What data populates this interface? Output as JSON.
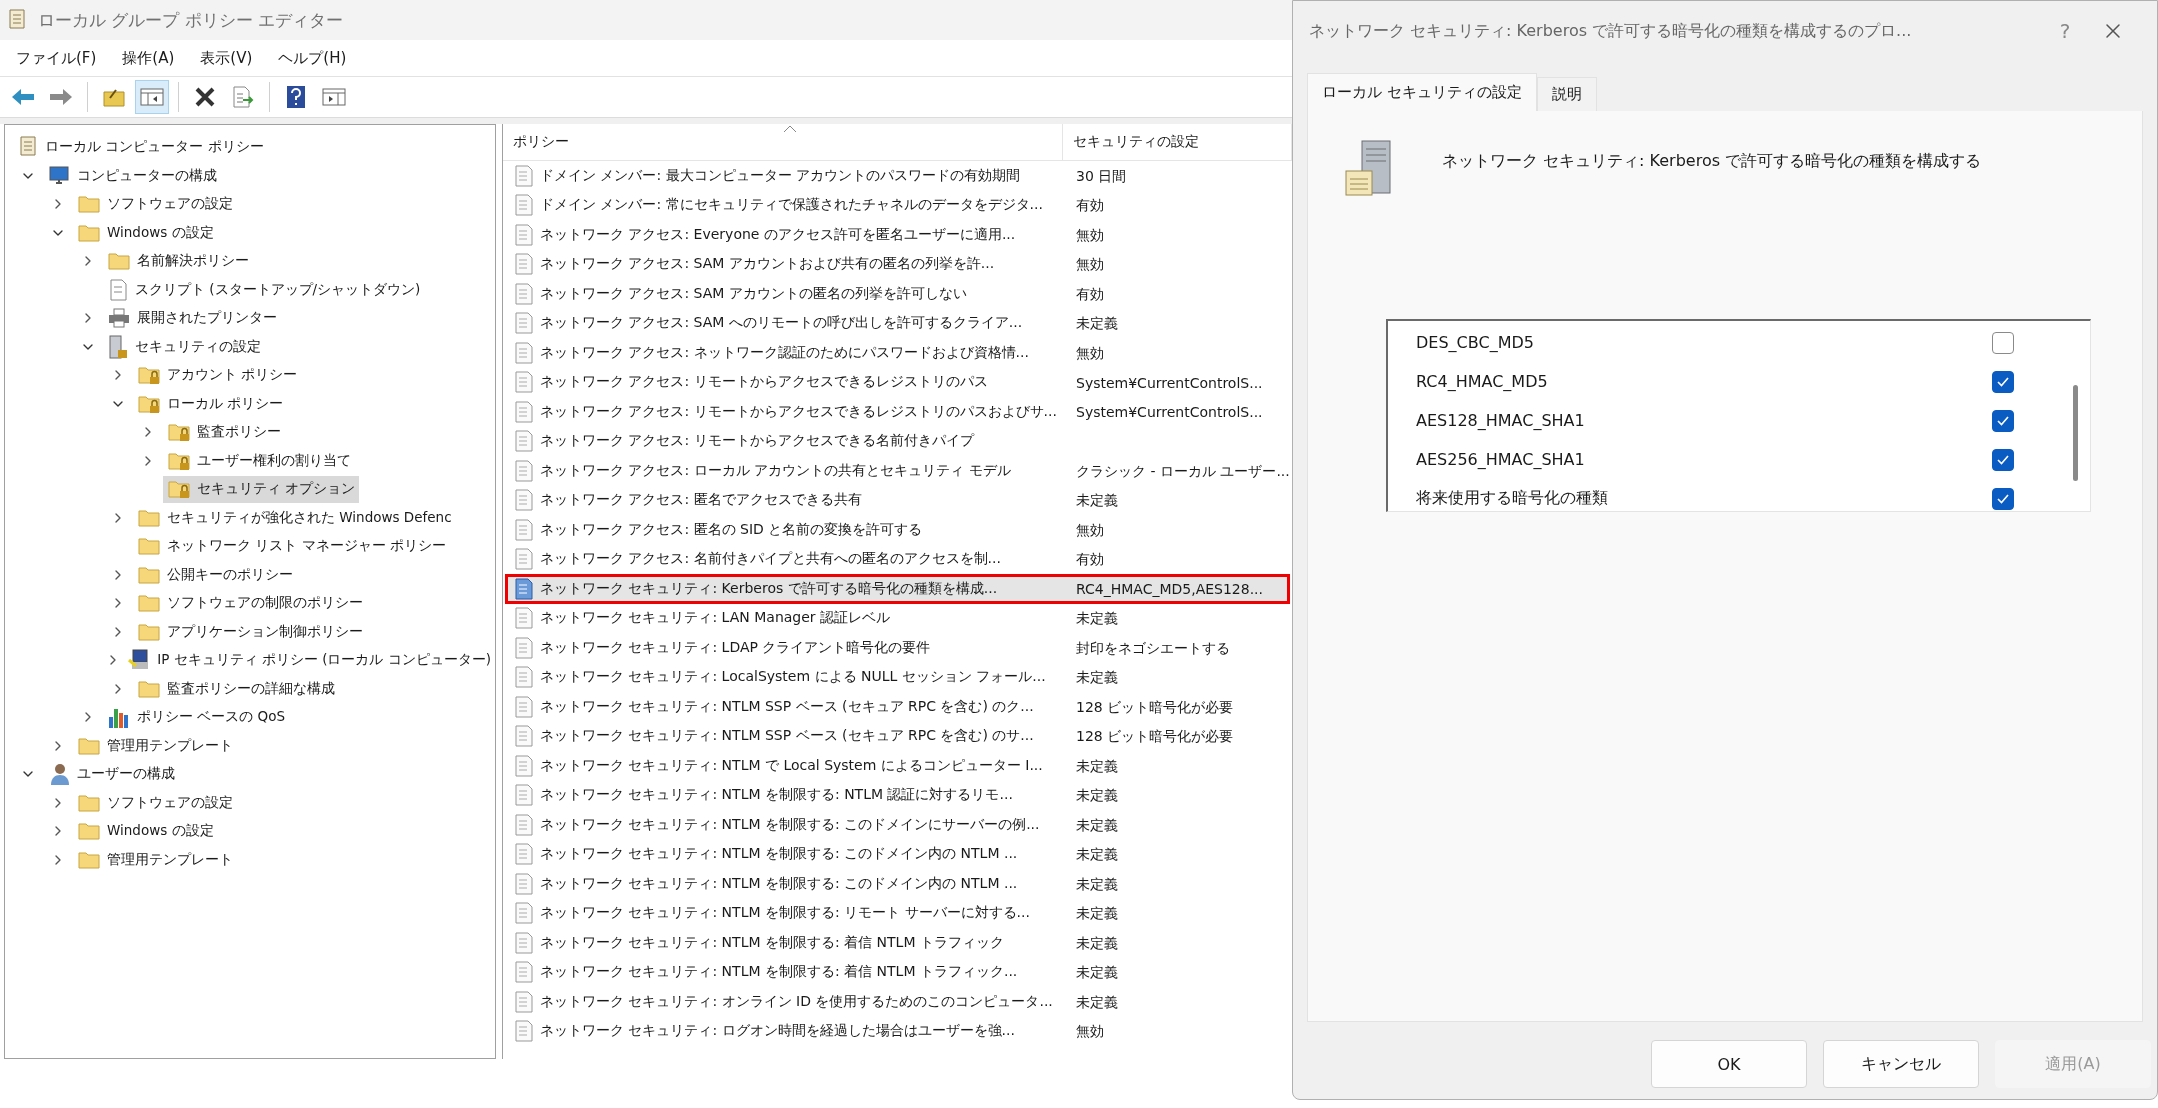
{
  "window": {
    "title": "ローカル グループ ポリシー エディター"
  },
  "menu": [
    "ファイル(F)",
    "操作(A)",
    "表示(V)",
    "ヘルプ(H)"
  ],
  "toolbar": [
    {
      "kind": "back",
      "pressed": false
    },
    {
      "kind": "forward",
      "pressed": false
    },
    {
      "kind": "separator"
    },
    {
      "kind": "up",
      "pressed": false
    },
    {
      "kind": "tree",
      "pressed": true
    },
    {
      "kind": "separator"
    },
    {
      "kind": "delete",
      "pressed": false
    },
    {
      "kind": "export",
      "pressed": false
    },
    {
      "kind": "separator"
    },
    {
      "kind": "help",
      "pressed": false
    },
    {
      "kind": "pane",
      "pressed": false
    }
  ],
  "tree": [
    {
      "label": "ローカル コンピューター ポリシー",
      "kind": "scroll",
      "selected": false,
      "children": [
        {
          "label": "コンピューターの構成",
          "kind": "computer",
          "expanded": true,
          "selected": false,
          "children": [
            {
              "label": "ソフトウェアの設定",
              "kind": "folder",
              "expanded": false,
              "selected": false
            },
            {
              "label": "Windows の設定",
              "kind": "folder",
              "expanded": true,
              "selected": false,
              "children": [
                {
                  "label": "名前解決ポリシー",
                  "kind": "folder",
                  "expanded": false,
                  "selected": false
                },
                {
                  "label": "スクリプト (スタートアップ/シャットダウン)",
                  "kind": "script",
                  "selected": false
                },
                {
                  "label": "展開されたプリンター",
                  "kind": "printer",
                  "expanded": false,
                  "selected": false
                },
                {
                  "label": "セキュリティの設定",
                  "kind": "server",
                  "expanded": true,
                  "selected": false,
                  "children": [
                    {
                      "label": "アカウント ポリシー",
                      "kind": "secure-folder",
                      "expanded": false,
                      "selected": false
                    },
                    {
                      "label": "ローカル ポリシー",
                      "kind": "secure-folder",
                      "expanded": true,
                      "selected": false,
                      "children": [
                        {
                          "label": "監査ポリシー",
                          "kind": "secure-folder",
                          "expanded": false,
                          "selected": false
                        },
                        {
                          "label": "ユーザー権利の割り当て",
                          "kind": "secure-folder",
                          "expanded": false,
                          "selected": false
                        },
                        {
                          "label": "セキュリティ オプション",
                          "kind": "secure-folder",
                          "selected": true
                        }
                      ]
                    },
                    {
                      "label": "セキュリティが強化された Windows Defenc",
                      "kind": "folder",
                      "expanded": false,
                      "selected": false
                    },
                    {
                      "label": "ネットワーク リスト マネージャー ポリシー",
                      "kind": "folder",
                      "selected": false
                    },
                    {
                      "label": "公開キーのポリシー",
                      "kind": "folder",
                      "expanded": false,
                      "selected": false
                    },
                    {
                      "label": "ソフトウェアの制限のポリシー",
                      "kind": "folder",
                      "expanded": false,
                      "selected": false
                    },
                    {
                      "label": "アプリケーション制御ポリシー",
                      "kind": "folder",
                      "expanded": false,
                      "selected": false
                    },
                    {
                      "label": "IP セキュリティ ポリシー (ローカル コンピューター)",
                      "kind": "ip",
                      "expanded": false,
                      "selected": false
                    },
                    {
                      "label": "監査ポリシーの詳細な構成",
                      "kind": "folder",
                      "expanded": false,
                      "selected": false
                    }
                  ]
                },
                {
                  "label": "ポリシー ベースの QoS",
                  "kind": "qos",
                  "expanded": false,
                  "selected": false
                }
              ]
            },
            {
              "label": "管理用テンプレート",
              "kind": "folder",
              "expanded": false,
              "selected": false
            }
          ]
        },
        {
          "label": "ユーザーの構成",
          "kind": "user",
          "expanded": true,
          "selected": false,
          "children": [
            {
              "label": "ソフトウェアの設定",
              "kind": "folder",
              "expanded": false,
              "selected": false
            },
            {
              "label": "Windows の設定",
              "kind": "folder",
              "expanded": false,
              "selected": false
            },
            {
              "label": "管理用テンプレート",
              "kind": "folder",
              "expanded": false,
              "selected": false
            }
          ]
        }
      ]
    }
  ],
  "table": {
    "columns": [
      {
        "label": "ポリシー",
        "sorted": true
      },
      {
        "label": "セキュリティの設定",
        "sorted": false
      }
    ],
    "rows": [
      {
        "policy": "ドメイン メンバー: 最大コンピューター アカウントのパスワードの有効期間",
        "setting": "30 日間",
        "selected": false
      },
      {
        "policy": "ドメイン メンバー: 常にセキュリティで保護されたチャネルのデータをデジタ...",
        "setting": "有効",
        "selected": false
      },
      {
        "policy": "ネットワーク アクセス: Everyone のアクセス許可を匿名ユーザーに適用...",
        "setting": "無効",
        "selected": false
      },
      {
        "policy": "ネットワーク アクセス: SAM アカウントおよび共有の匿名の列挙を許...",
        "setting": "無効",
        "selected": false
      },
      {
        "policy": "ネットワーク アクセス: SAM アカウントの匿名の列挙を許可しない",
        "setting": "有効",
        "selected": false
      },
      {
        "policy": "ネットワーク アクセス: SAM へのリモートの呼び出しを許可するクライア...",
        "setting": "未定義",
        "selected": false
      },
      {
        "policy": "ネットワーク アクセス: ネットワーク認証のためにパスワードおよび資格情...",
        "setting": "無効",
        "selected": false
      },
      {
        "policy": "ネットワーク アクセス: リモートからアクセスできるレジストリのパス",
        "setting": "System¥CurrentControlS...",
        "selected": false
      },
      {
        "policy": "ネットワーク アクセス: リモートからアクセスできるレジストリのパスおよびサ...",
        "setting": "System¥CurrentControlS...",
        "selected": false
      },
      {
        "policy": "ネットワーク アクセス: リモートからアクセスできる名前付きパイプ",
        "selected": false
      },
      {
        "policy": "ネットワーク アクセス: ローカル アカウントの共有とセキュリティ モデル",
        "setting": "クラシック - ローカル ユーザー...",
        "selected": false
      },
      {
        "policy": "ネットワーク アクセス: 匿名でアクセスできる共有",
        "setting": "未定義",
        "selected": false
      },
      {
        "policy": "ネットワーク アクセス: 匿名の SID と名前の変換を許可する",
        "setting": "無効",
        "selected": false
      },
      {
        "policy": "ネットワーク アクセス: 名前付きパイプと共有への匿名のアクセスを制...",
        "setting": "有効",
        "selected": false
      },
      {
        "policy": "ネットワーク セキュリティ: Kerberos で許可する暗号化の種類を構成...",
        "setting": "RC4_HMAC_MD5,AES128...",
        "selected": true
      },
      {
        "policy": "ネットワーク セキュリティ: LAN Manager 認証レベル",
        "setting": "未定義",
        "selected": false
      },
      {
        "policy": "ネットワーク セキュリティ: LDAP クライアント暗号化の要件",
        "setting": "封印をネゴシエートする",
        "selected": false
      },
      {
        "policy": "ネットワーク セキュリティ: LocalSystem による NULL セッション フォール...",
        "setting": "未定義",
        "selected": false
      },
      {
        "policy": "ネットワーク セキュリティ: NTLM SSP ベース (セキュア RPC を含む) のク...",
        "setting": "128 ビット暗号化が必要",
        "selected": false
      },
      {
        "policy": "ネットワーク セキュリティ: NTLM SSP ベース (セキュア RPC を含む) のサ...",
        "setting": "128 ビット暗号化が必要",
        "selected": false
      },
      {
        "policy": "ネットワーク セキュリティ: NTLM で Local System によるコンピューター I...",
        "setting": "未定義",
        "selected": false
      },
      {
        "policy": "ネットワーク セキュリティ: NTLM を制限する: NTLM 認証に対するリモ...",
        "setting": "未定義",
        "selected": false
      },
      {
        "policy": "ネットワーク セキュリティ: NTLM を制限する: このドメインにサーバーの例...",
        "setting": "未定義",
        "selected": false
      },
      {
        "policy": "ネットワーク セキュリティ: NTLM を制限する: このドメイン内の NTLM ...",
        "setting": "未定義",
        "selected": false
      },
      {
        "policy": "ネットワーク セキュリティ: NTLM を制限する: このドメイン内の NTLM ...",
        "setting": "未定義",
        "selected": false
      },
      {
        "policy": "ネットワーク セキュリティ: NTLM を制限する: リモート サーバーに対する...",
        "setting": "未定義",
        "selected": false
      },
      {
        "policy": "ネットワーク セキュリティ: NTLM を制限する: 着信 NTLM トラフィック",
        "setting": "未定義",
        "selected": false
      },
      {
        "policy": "ネットワーク セキュリティ: NTLM を制限する: 着信 NTLM トラフィック...",
        "setting": "未定義",
        "selected": false
      },
      {
        "policy": "ネットワーク セキュリティ: オンライン ID を使用するためのこのコンピュータ...",
        "setting": "未定義",
        "selected": false
      },
      {
        "policy": "ネットワーク セキュリティ: ログオン時間を経過した場合はユーザーを強...",
        "setting": "無効",
        "selected": false
      }
    ]
  },
  "dialog": {
    "title": "ネットワーク セキュリティ: Kerberos で許可する暗号化の種類を構成するのプロ...",
    "help": "?",
    "tabs": [
      {
        "label": "ローカル セキュリティの設定",
        "selected": true
      },
      {
        "label": "説明",
        "selected": false
      }
    ],
    "heading": "ネットワーク セキュリティ: Kerberos で許可する暗号化の種類を構成する",
    "options": [
      {
        "label": "DES_CBC_MD5",
        "checked": false
      },
      {
        "label": "RC4_HMAC_MD5",
        "checked": true
      },
      {
        "label": "AES128_HMAC_SHA1",
        "checked": true
      },
      {
        "label": "AES256_HMAC_SHA1",
        "checked": true
      },
      {
        "label": "将来使用する暗号化の種類",
        "checked": true
      }
    ],
    "buttons": [
      {
        "label": "OK",
        "disabled": false
      },
      {
        "label": "キャンセル",
        "disabled": false
      },
      {
        "label": "適用(A)",
        "disabled": true
      }
    ]
  }
}
